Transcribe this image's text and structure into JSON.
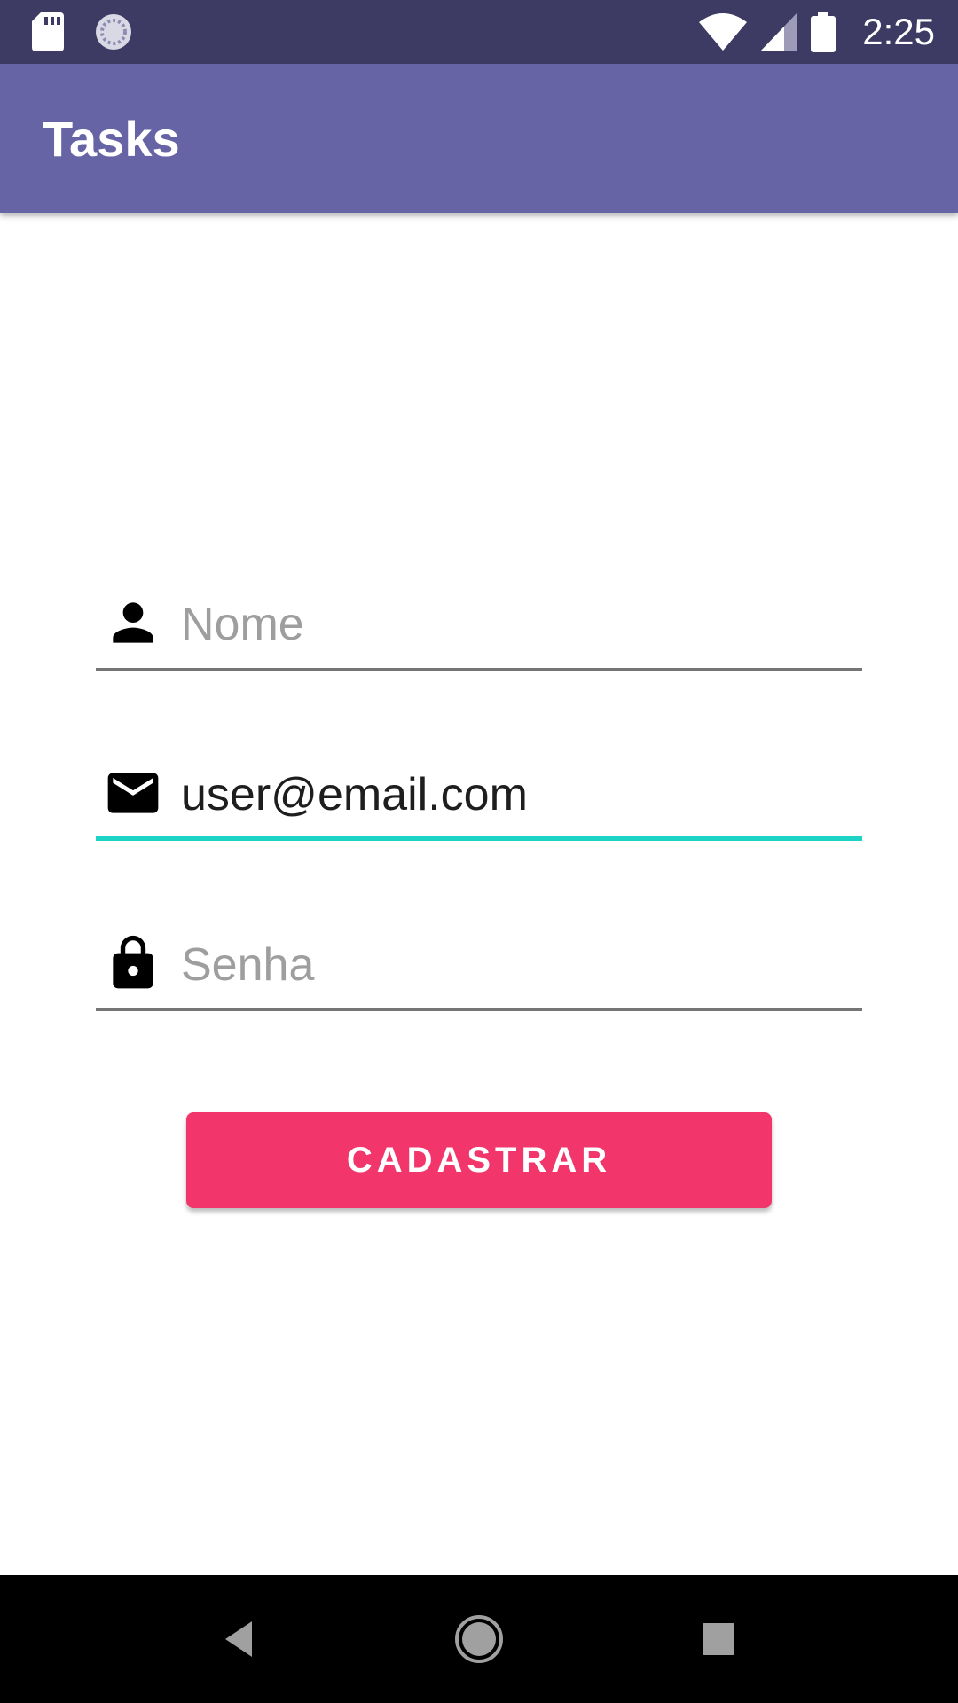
{
  "status_bar": {
    "time": "2:25",
    "icons": [
      "sd-card-icon",
      "sync-icon",
      "wifi-icon",
      "signal-icon",
      "battery-icon"
    ]
  },
  "app_bar": {
    "title": "Tasks"
  },
  "form": {
    "name_field": {
      "placeholder": "Nome",
      "value": ""
    },
    "email_field": {
      "placeholder": "",
      "value": "user@email.com"
    },
    "password_field": {
      "placeholder": "Senha",
      "value": ""
    },
    "submit_label": "CADASTRAR"
  },
  "colors": {
    "status_bar": "#3d3a63",
    "app_bar": "#6764a6",
    "accent": "#1dd3c6",
    "button": "#f2366b"
  },
  "nav_bar": {
    "buttons": [
      "back-icon",
      "home-icon",
      "recents-icon"
    ]
  }
}
